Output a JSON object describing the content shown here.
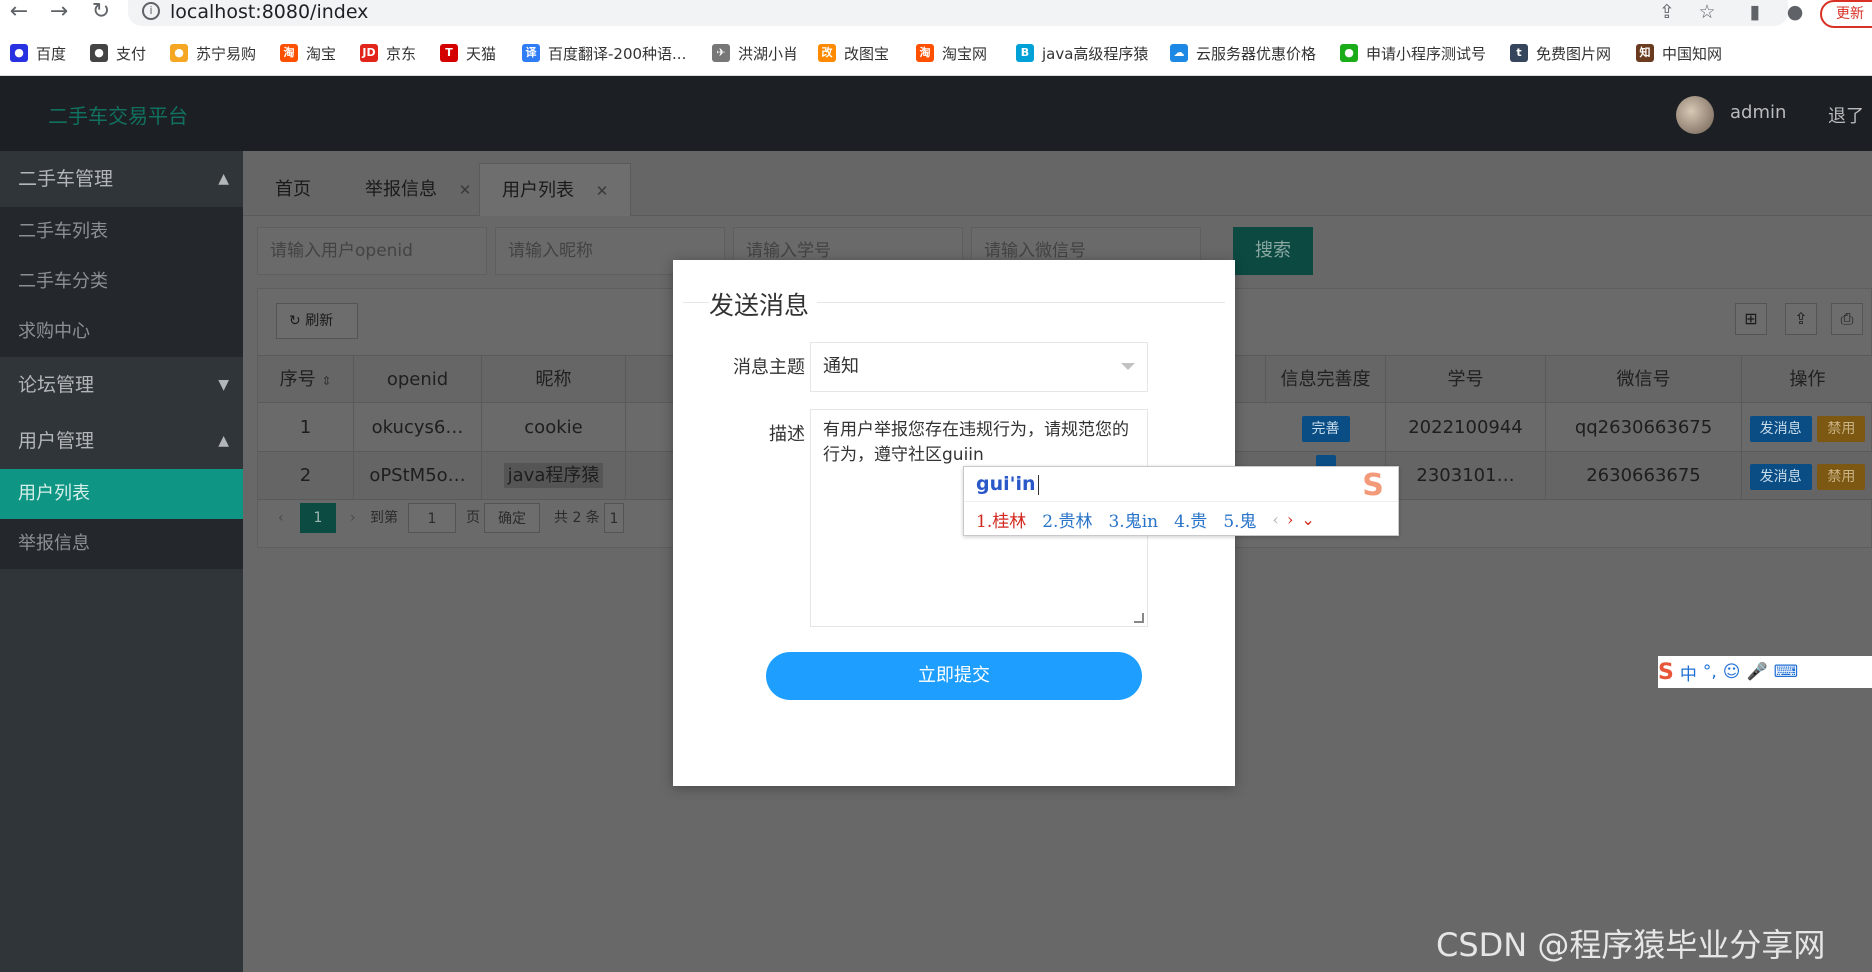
{
  "browser": {
    "url": "localhost:8080/index",
    "update_label": "更新",
    "bookmarks": [
      {
        "label": "百度",
        "icon": "baidu-icon",
        "color": "#2932e1",
        "glyph": "●"
      },
      {
        "label": "支付",
        "icon": "alipay-icon",
        "color": "#444444",
        "glyph": "●"
      },
      {
        "label": "苏宁易购",
        "icon": "suning-icon",
        "color": "#f5a623",
        "glyph": "●"
      },
      {
        "label": "淘宝",
        "icon": "taobao-icon",
        "color": "#ff5000",
        "glyph": "淘"
      },
      {
        "label": "京东",
        "icon": "jd-icon",
        "color": "#e1251b",
        "glyph": "JD"
      },
      {
        "label": "天猫",
        "icon": "tmall-icon",
        "color": "#d40000",
        "glyph": "T"
      },
      {
        "label": "百度翻译-200种语...",
        "icon": "translate-icon",
        "color": "#2e7cf6",
        "glyph": "译"
      },
      {
        "label": "洪湖小肖",
        "icon": "bird-icon",
        "color": "#777777",
        "glyph": "✈"
      },
      {
        "label": "改图宝",
        "icon": "gaitubao-icon",
        "color": "#ff8a00",
        "glyph": "改"
      },
      {
        "label": "淘宝网",
        "icon": "taobaowang-icon",
        "color": "#ff5000",
        "glyph": "淘"
      },
      {
        "label": "java高级程序猿",
        "icon": "bilibili-icon",
        "color": "#00a1d6",
        "glyph": "B"
      },
      {
        "label": "云服务器优惠价格",
        "icon": "cloud-icon",
        "color": "#1e88e5",
        "glyph": "☁"
      },
      {
        "label": "申请小程序测试号",
        "icon": "wechat-icon",
        "color": "#1aad19",
        "glyph": "●"
      },
      {
        "label": "免费图片网",
        "icon": "tumblr-icon",
        "color": "#35465c",
        "glyph": "t"
      },
      {
        "label": "中国知网",
        "icon": "cnki-icon",
        "color": "#6b3b1f",
        "glyph": "知"
      }
    ]
  },
  "header": {
    "title": "二手车交易平台",
    "user": "admin",
    "logout": "退了"
  },
  "sidebar": {
    "groups": [
      {
        "label": "二手车管理",
        "arrow": "▲"
      },
      {
        "label": "论坛管理",
        "arrow": "▼"
      },
      {
        "label": "用户管理",
        "arrow": "▲"
      }
    ],
    "items": [
      {
        "label": "二手车列表"
      },
      {
        "label": "二手车分类"
      },
      {
        "label": "求购中心"
      },
      {
        "label": "用户列表"
      },
      {
        "label": "举报信息"
      }
    ]
  },
  "tabs": [
    {
      "label": "首页"
    },
    {
      "label": "举报信息",
      "close": "✕"
    },
    {
      "label": "用户列表",
      "close": "✕"
    }
  ],
  "search": {
    "openid_placeholder": "请输入用户openid",
    "nickname_placeholder": "请输入昵称",
    "student_id_placeholder": "请输入学号",
    "wechat_placeholder": "请输入微信号",
    "button": "搜索"
  },
  "toolbar": {
    "refresh": "刷新"
  },
  "table": {
    "headers": {
      "index": "序号",
      "openid": "openid",
      "nickname": "昵称",
      "completeness": "信息完善度",
      "student_id": "学号",
      "wechat": "微信号",
      "actions": "操作"
    },
    "rows": [
      {
        "index": "1",
        "openid": "okucys6…",
        "nickname": "cookie",
        "completeness": "完善",
        "student_id": "2022100944",
        "wechat": "qq2630663675",
        "send": "发消息",
        "ban": "禁用"
      },
      {
        "index": "2",
        "openid": "oPStM5o…",
        "nickname": "java程序猿",
        "completeness": "",
        "student_id": "2303101…",
        "wechat": "2630663675",
        "send": "发消息",
        "ban": "禁用"
      }
    ]
  },
  "pagination": {
    "current_page": "1",
    "goto_label": "到第",
    "goto_value": "1",
    "page_label": "页",
    "confirm": "确定",
    "total": "共 2 条",
    "size_cut": "1"
  },
  "modal": {
    "title": "发送消息",
    "topic_label": "消息主题",
    "topic_value": "通知",
    "desc_label": "描述",
    "desc_value": "有用户举报您存在违规行为，请规范您的行为，遵守社区guiin",
    "submit": "立即提交"
  },
  "ime": {
    "input": "gui'in",
    "candidates": [
      "1.桂林",
      "2.贵林",
      "3.鬼in",
      "4.贵",
      "5.鬼"
    ],
    "prev": "‹",
    "next": "›",
    "expand": "⌄",
    "toolbar": [
      "中",
      "°,",
      "☺",
      "🎤",
      "⌨"
    ]
  },
  "watermark": "CSDN @程序猿毕业分享网"
}
